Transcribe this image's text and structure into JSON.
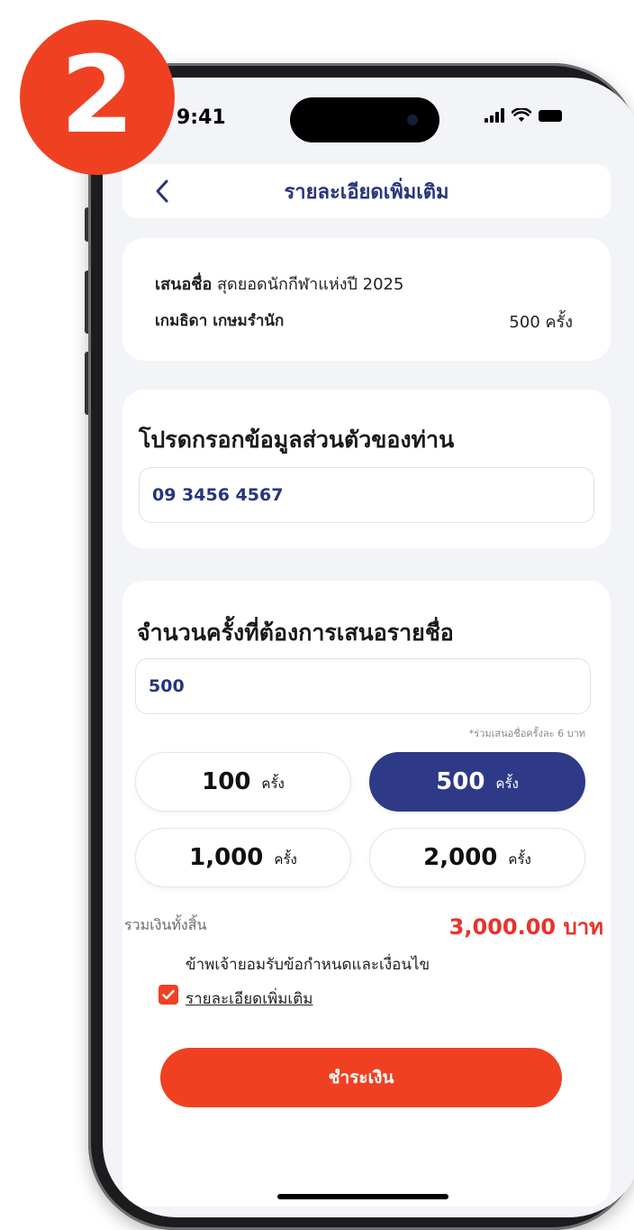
{
  "step_badge": {
    "number": "2"
  },
  "status_bar": {
    "time": "9:41"
  },
  "header": {
    "title": "รายละเอียดเพิ่มเติม",
    "back_icon": "chevron-left-icon"
  },
  "nominee": {
    "label": "เสนอชื่อ",
    "award": "สุดยอดนักกีฬาแห่งปี 2025",
    "name": "เกมธิดา เกษมรำนัก",
    "count": "500 ครั้ง"
  },
  "personal_info": {
    "title": "โปรดกรอกข้อมูลส่วนตัวของท่าน",
    "phone_value": "09 3456 4567"
  },
  "vote": {
    "title": "จำนวนครั้งที่ต้องการเสนอรายชื่อ",
    "amount_value": "500",
    "price_note": "*ร่วมเสนอชื่อครั้งละ 6 บาท",
    "options": [
      {
        "num": "100",
        "unit": "ครั้ง",
        "selected": false
      },
      {
        "num": "500",
        "unit": "ครั้ง",
        "selected": true
      },
      {
        "num": "1,000",
        "unit": "ครั้ง",
        "selected": false
      },
      {
        "num": "2,000",
        "unit": "ครั้ง",
        "selected": false
      }
    ],
    "total_label": "รวมเงินทั้งสิ้น",
    "total_value": "3,000.00 บาท"
  },
  "terms": {
    "checked": true,
    "text": "ข้าพเจ้ายอมรับข้อกำหนดและเงื่อนไข",
    "link": "รายละเอียดเพิ่มเติม"
  },
  "pay_button": {
    "label": "ชำระเงิน"
  },
  "colors": {
    "accent_red": "#ef4122",
    "brand_navy": "#2e3a87",
    "title_navy": "#27357c",
    "total_red": "#e9322a"
  }
}
